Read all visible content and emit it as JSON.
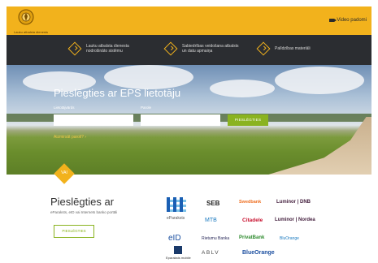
{
  "header": {
    "logo_text": "Lauku atbalsta dienests",
    "video_link": "Video padomi"
  },
  "nav": [
    {
      "label": "Lauku atbalsta dienesta nodrošināto sistēmu"
    },
    {
      "label": "Sabiedrības veidošana atbalsts un datu apmaiņa"
    },
    {
      "label": "Palīdzības materiāli"
    }
  ],
  "login": {
    "title": "Pieslēgties ar EPS lietotāju",
    "username_label": "Lietotājvārds",
    "password_label": "Parole",
    "connect_button": "PIESLĒGTIES",
    "forgot_link": "Aizmirsāt paroli?  ›"
  },
  "divider": {
    "label": "VAI"
  },
  "bank_login": {
    "title": "Pieslēgties ar",
    "subtitle": "eParaksts, eID vai Internets banko portāli",
    "connect_button": "PIESLĒGTIES",
    "providers": [
      "eParaksts",
      "SEB",
      "MTB",
      "Swedbank",
      "Citadele",
      "Luminor | DNB",
      "Luminor | Nordea",
      "eID",
      "Rietumu Banka",
      "PrivatBank",
      "BluOrange",
      "ABLV",
      "Eparaksts mobile"
    ]
  },
  "colors": {
    "accent": "#f2b21c",
    "nav_bg": "#2b2d31",
    "button_green": "#8ab320"
  }
}
